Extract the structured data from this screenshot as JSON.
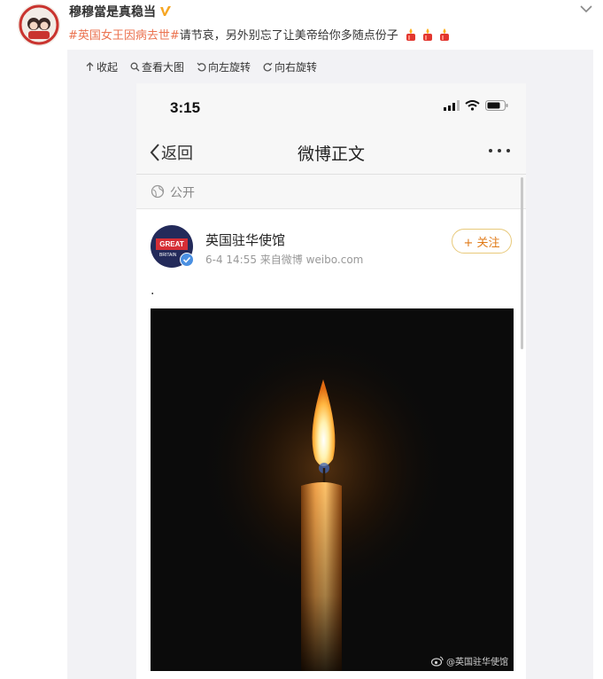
{
  "post": {
    "username": "穆穆當是真稳当",
    "hashtag": "#英国女王因病去世#",
    "text": " 请节哀，另外别忘了让美帝给你多随点份子",
    "verified_icon": "v-badge-icon",
    "candle_count": 3
  },
  "toolbar": {
    "collapse": "收起",
    "view_large": "查看大图",
    "rotate_left": "向左旋转",
    "rotate_right": "向右旋转"
  },
  "phone": {
    "status_time": "3:15",
    "nav_back": "返回",
    "nav_title": "微博正文",
    "visibility": "公开",
    "author_name": "英国驻华使馆",
    "post_meta": "6-4 14:55  来自微博 weibo.com",
    "follow_label": "+ 关注",
    "body_text": ".",
    "avatar_text": "GREAT",
    "avatar_subtext": "BRITAIN",
    "watermark": "@英国驻华使馆"
  },
  "colors": {
    "hashtag": "#eb7350",
    "follow": "#e07a17",
    "verified": "#f6a623"
  }
}
